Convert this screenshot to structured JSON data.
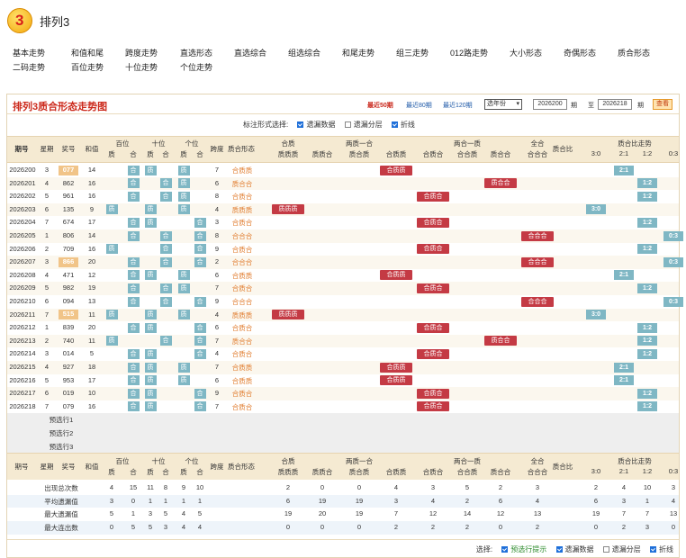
{
  "app": {
    "title": "排列3",
    "logo_text": "3"
  },
  "nav": [
    "基本走势",
    "和值和尾",
    "跨度走势",
    "直选形态",
    "直选综合",
    "组选综合",
    "和尾走势",
    "组三走势",
    "012路走势",
    "大小形态",
    "奇偶形态",
    "质合形态",
    "二码走势",
    "百位走势",
    "十位走势",
    "个位走势"
  ],
  "panel": {
    "title": "排列3质合形态走势图",
    "quick": [
      "最近50期",
      "最近80期",
      "最近120期"
    ],
    "year_select": "选年份",
    "from_label": "期",
    "to_label": "至",
    "to_suffix": "期",
    "from_value": "2026200",
    "to_value": "2026218",
    "query_button": "查看"
  },
  "options": {
    "label": "标注形式选择:",
    "items": [
      {
        "label": "遗漏数据",
        "checked": true
      },
      {
        "label": "遗漏分层",
        "checked": false
      },
      {
        "label": "折线",
        "checked": true
      }
    ]
  },
  "header": {
    "top": [
      "期号",
      "星期",
      "奖号",
      "和值",
      "百位",
      "十位",
      "个位",
      "跨度",
      "质合形态",
      "合质",
      "两质一合",
      "两合一质",
      "全合",
      "质合比",
      "质合比走势"
    ],
    "sub": [
      "质",
      "合",
      "质",
      "合",
      "质",
      "合",
      "质质质",
      "质质合",
      "质合质",
      "合质质",
      "合质合",
      "合合质",
      "质合合",
      "合合合",
      "3:0",
      "2:1",
      "1:2",
      "0:3"
    ]
  },
  "colors": {
    "accent": "#cc2a1c",
    "tag": "#c43a44",
    "ratio": "#7fb7c4",
    "highlight": "#f1c488"
  },
  "rows": [
    {
      "issue": "2026200",
      "wd": "3",
      "num": "077",
      "sum": "14",
      "span": "7",
      "hl": true,
      "bw": [
        "1",
        "4",
        "2"
      ],
      "ratio": "2:1",
      "type": "合质质"
    },
    {
      "issue": "2026201",
      "wd": "4",
      "num": "862",
      "sum": "16",
      "span": "6",
      "ratio": "1:2",
      "type": "质合合"
    },
    {
      "issue": "2026202",
      "wd": "5",
      "num": "961",
      "sum": "16",
      "span": "8",
      "ratio": "1:2",
      "type": "合质合"
    },
    {
      "issue": "2026203",
      "wd": "6",
      "num": "135",
      "sum": "9",
      "span": "4",
      "ratio": "3:0",
      "type": "质质质"
    },
    {
      "issue": "2026204",
      "wd": "7",
      "num": "674",
      "sum": "17",
      "span": "3",
      "ratio": "1:2",
      "type": "合质合"
    },
    {
      "issue": "2026205",
      "wd": "1",
      "num": "806",
      "sum": "14",
      "span": "8",
      "ratio": "0:3",
      "type": "合合合"
    },
    {
      "issue": "2026206",
      "wd": "2",
      "num": "709",
      "sum": "16",
      "span": "9",
      "ratio": "1:2",
      "type": "合质合"
    },
    {
      "issue": "2026207",
      "wd": "3",
      "num": "866",
      "sum": "20",
      "span": "2",
      "hl": true,
      "ratio": "0:3",
      "type": "合合合"
    },
    {
      "issue": "2026208",
      "wd": "4",
      "num": "471",
      "sum": "12",
      "span": "6",
      "ratio": "2:1",
      "type": "合质质"
    },
    {
      "issue": "2026209",
      "wd": "5",
      "num": "982",
      "sum": "19",
      "span": "7",
      "ratio": "1:2",
      "type": "合质合"
    },
    {
      "issue": "2026210",
      "wd": "6",
      "num": "094",
      "sum": "13",
      "span": "9",
      "ratio": "0:3",
      "type": "合合合"
    },
    {
      "issue": "2026211",
      "wd": "7",
      "num": "515",
      "sum": "11",
      "span": "4",
      "hl": true,
      "ratio": "3:0",
      "type": "质质质"
    },
    {
      "issue": "2026212",
      "wd": "1",
      "num": "839",
      "sum": "20",
      "span": "6",
      "ratio": "1:2",
      "type": "合质合"
    },
    {
      "issue": "2026213",
      "wd": "2",
      "num": "740",
      "sum": "11",
      "span": "7",
      "ratio": "1:2",
      "type": "质合合"
    },
    {
      "issue": "2026214",
      "wd": "3",
      "num": "014",
      "sum": "5",
      "span": "4",
      "ratio": "1:2",
      "type": "合质合"
    },
    {
      "issue": "2026215",
      "wd": "4",
      "num": "927",
      "sum": "18",
      "span": "7",
      "ratio": "2:1",
      "type": "合质质"
    },
    {
      "issue": "2026216",
      "wd": "5",
      "num": "953",
      "sum": "17",
      "span": "6",
      "ratio": "2:1",
      "type": "合质质"
    },
    {
      "issue": "2026217",
      "wd": "6",
      "num": "019",
      "sum": "10",
      "span": "9",
      "ratio": "1:2",
      "type": "合质合"
    },
    {
      "issue": "2026218",
      "wd": "7",
      "num": "079",
      "sum": "16",
      "span": "7",
      "ratio": "1:2",
      "type": "合质合"
    }
  ],
  "pre_rows": [
    "预选行1",
    "预选行2",
    "预选行3"
  ],
  "stats": [
    {
      "label": "出现总次数",
      "vals": [
        "4",
        "15",
        "11",
        "8",
        "9",
        "10",
        "",
        "2",
        "0",
        "0",
        "4",
        "3",
        "5",
        "2",
        "3",
        "2",
        "4",
        "10",
        "3"
      ]
    },
    {
      "label": "平均遗漏值",
      "vals": [
        "3",
        "0",
        "1",
        "1",
        "1",
        "1",
        "",
        "6",
        "19",
        "19",
        "3",
        "4",
        "2",
        "6",
        "4",
        "6",
        "3",
        "1",
        "4"
      ]
    },
    {
      "label": "最大遗漏值",
      "vals": [
        "5",
        "1",
        "3",
        "5",
        "4",
        "5",
        "",
        "19",
        "20",
        "19",
        "7",
        "12",
        "14",
        "12",
        "13",
        "19",
        "7",
        "7",
        "13"
      ]
    },
    {
      "label": "最大连出数",
      "vals": [
        "0",
        "5",
        "5",
        "3",
        "4",
        "4",
        "",
        "0",
        "0",
        "0",
        "2",
        "2",
        "2",
        "0",
        "2",
        "0",
        "2",
        "3",
        "0"
      ]
    }
  ],
  "footer": {
    "label": "选择:",
    "items": [
      {
        "label": "预选行提示",
        "checked": true
      },
      {
        "label": "遗漏数据",
        "checked": true
      },
      {
        "label": "遗漏分层",
        "checked": false
      },
      {
        "label": "折线",
        "checked": true
      }
    ]
  }
}
